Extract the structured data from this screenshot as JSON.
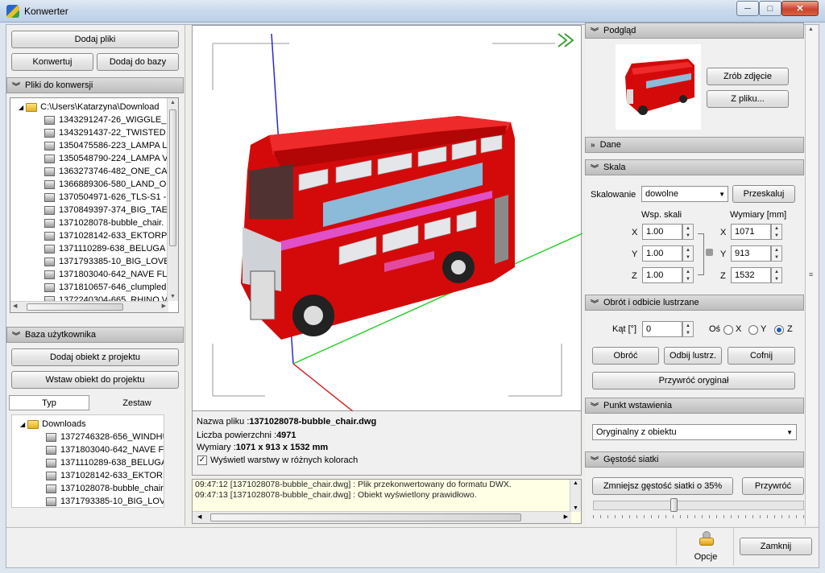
{
  "window": {
    "title": "Konwerter",
    "minimize": "─",
    "maximize": "□",
    "close": "✕"
  },
  "left": {
    "btn_add_files": "Dodaj pliki",
    "btn_convert": "Konwertuj",
    "btn_add_to_db": "Dodaj do bazy",
    "files_section": "Pliki do konwersji",
    "root_folder": "C:\\Users\\Katarzyna\\Download",
    "files": [
      "1343291247-26_WIGGLE_",
      "1343291437-22_TWISTED",
      "1350475586-223_LAMPA L",
      "1350548790-224_LAMPA V",
      "1363273746-482_ONE_CA",
      "1366889306-580_LAND_O",
      "1370504971-626_TLS-S1 -",
      "1370849397-374_BIG_TAE",
      "1371028078-bubble_chair.",
      "1371028142-633_EKTORP",
      "1371110289-638_BELUGA",
      "1371793385-10_BIG_LOVE",
      "1371803040-642_NAVE FL",
      "1371810657-646_clumpled",
      "1372240304-665_RHINO V"
    ],
    "user_db_section": "Baza użytkownika",
    "btn_add_object": "Dodaj obiekt z projektu",
    "btn_insert_object": "Wstaw obiekt do projektu",
    "tab_type": "Typ",
    "tab_set": "Zestaw",
    "db_folder": "Downloads",
    "db_files": [
      "1372746328-656_WINDHU",
      "1371803040-642_NAVE FL",
      "1371110289-638_BELUGA",
      "1371028142-633_EKTORP",
      "1371028078-bubble_chair",
      "1371793385-10_BIG_LOVI"
    ]
  },
  "viewer": {
    "filename_label": "Nazwa pliku :",
    "filename_value": "1371028078-bubble_chair.dwg",
    "surfaces_label": "Liczba powierzchni :",
    "surfaces_value": "4971",
    "dims_label": "Wymiary :",
    "dims_value": "1071 x 913 x 1532 mm",
    "layers_checkbox": "Wyświetl warstwy w różnych kolorach",
    "layers_checked": true,
    "bus_advert": "~~~~~~~"
  },
  "log": {
    "lines": [
      "09:47:12 [1371028078-bubble_chair.dwg] : Plik przekonwertowany do formatu DWX.",
      "09:47:13 [1371028078-bubble_chair.dwg] : Obiekt wyświetlony prawidłowo."
    ]
  },
  "right": {
    "preview_section": "Podgląd",
    "btn_snapshot": "Zrób zdjęcie",
    "btn_from_file": "Z pliku...",
    "data_section": "Dane",
    "scale_section": "Skala",
    "scaling_label": "Skalowanie",
    "scaling_value": "dowolne",
    "btn_rescale": "Przeskaluj",
    "scale_factor_label": "Wsp. skali",
    "dimensions_label": "Wymiary [mm]",
    "axis_x": "X",
    "axis_y": "Y",
    "axis_z": "Z",
    "scale_x": "1.00",
    "scale_y": "1.00",
    "scale_z": "1.00",
    "dim_x": "1071",
    "dim_y": "913",
    "dim_z": "1532",
    "rotation_section": "Obrót i odbicie lustrzane",
    "angle_label": "Kąt [°]",
    "angle_value": "0",
    "axis_label": "Oś",
    "btn_rotate": "Obróć",
    "btn_mirror": "Odbij lustrz.",
    "btn_undo": "Cofnij",
    "btn_restore": "Przywróć oryginał",
    "insertion_section": "Punkt wstawienia",
    "insertion_value": "Oryginalny z obiektu",
    "density_section": "Gęstość siatki",
    "btn_reduce": "Zmniejsz gęstość siatki o 35%",
    "btn_density_restore": "Przywróć",
    "density_level": 0.38
  },
  "footer": {
    "options_label": "Opcje",
    "close_label": "Zamknij"
  }
}
